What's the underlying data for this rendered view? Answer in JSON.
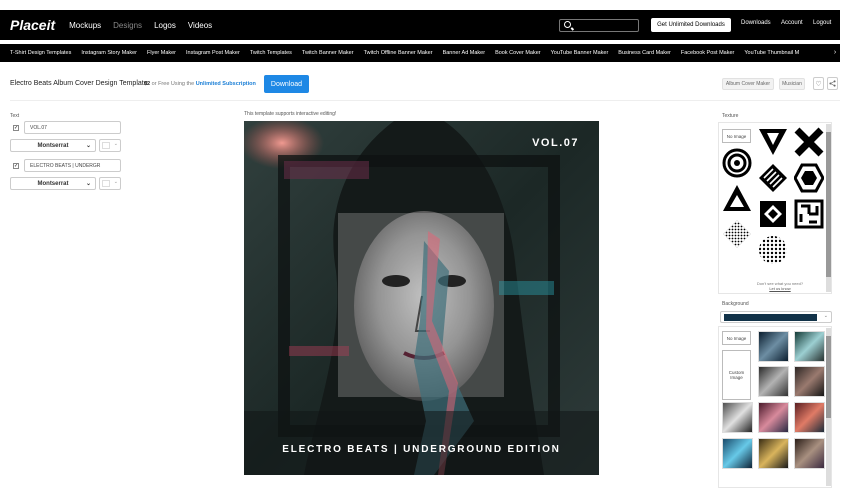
{
  "topnav": {
    "logo": "Placeit",
    "links": [
      "Mockups",
      "Designs",
      "Logos",
      "Videos"
    ],
    "get_unlimited": "Get Unlimited Downloads",
    "right_links": [
      "Downloads",
      "Account",
      "Logout"
    ]
  },
  "categories": [
    "T-Shirt Design Templates",
    "Instagram Story Maker",
    "Flyer Maker",
    "Instagram Post Maker",
    "Twitch Templates",
    "Twitch Banner Maker",
    "Twitch Offline Banner Maker",
    "Banner Ad Maker",
    "Book Cover Maker",
    "YouTube Banner Maker",
    "Business Card Maker",
    "Facebook Post Maker",
    "YouTube Thumbnail M"
  ],
  "title_row": {
    "title": "Electro Beats Album Cover Design Template",
    "price": "$2",
    "price_or": "or Free Using the",
    "subscription": "Unlimited Subscription",
    "download": "Download",
    "tags": [
      "Album Cover Maker",
      "Musician"
    ]
  },
  "left_panel": {
    "text_label": "Text",
    "fields": [
      {
        "value": "VOL.07",
        "font": "Montserrat"
      },
      {
        "value": "ELECTRO BEATS | UNDERGR",
        "font": "Montserrat"
      }
    ]
  },
  "preview": {
    "note": "This template supports interactive editing!",
    "vol_text": "VOL.07",
    "title_text": "ELECTRO BEATS | UNDERGROUND EDITION"
  },
  "right_panel": {
    "texture_label": "Texture",
    "no_image": "No Image",
    "texture_icons": [
      "v-shape-icon",
      "x-shape-icon",
      "concentric-circles-icon",
      "diamond-lines-icon",
      "hexagon-icon",
      "triangle-icon",
      "diamond-square-icon",
      "maze-square-icon",
      "dots-diamond-icon",
      "dots-circle-icon"
    ],
    "help_text": "Don't see what you need?",
    "help_link": "Let us know",
    "background_label": "Background",
    "bg_color": "#123349",
    "custom_image": "Custom Image"
  }
}
